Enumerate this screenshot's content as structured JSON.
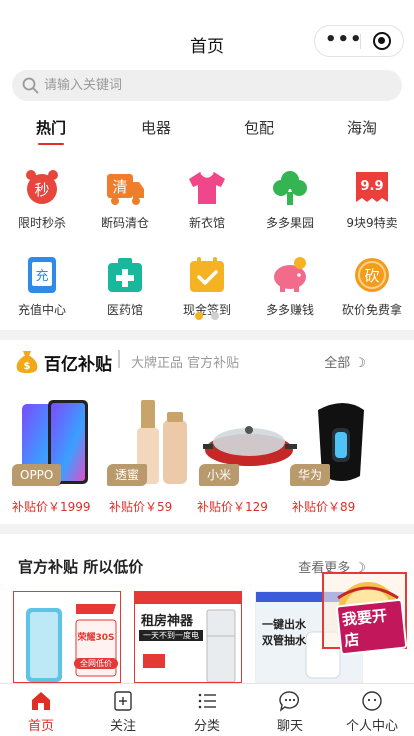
{
  "header": {
    "title": "首页"
  },
  "search": {
    "placeholder": "请输入关键词"
  },
  "tabs": [
    {
      "label": "热门"
    },
    {
      "label": "电器"
    },
    {
      "label": "包配"
    },
    {
      "label": "海淘"
    }
  ],
  "categories": [
    {
      "label": "限时秒杀",
      "icon": "flash-sale-clock-icon",
      "glyph": "秒",
      "color": "#e8453c"
    },
    {
      "label": "断码清仓",
      "icon": "clearance-truck-icon",
      "glyph": "清",
      "color": "#f07d2a"
    },
    {
      "label": "新衣馆",
      "icon": "tshirt-icon",
      "color": "#f0468a"
    },
    {
      "label": "多多果园",
      "icon": "tree-icon",
      "color": "#35b552"
    },
    {
      "label": "9块9特卖",
      "icon": "nine-nine-icon",
      "glyph": "9.9",
      "color": "#ea3f3a"
    },
    {
      "label": "充值中心",
      "icon": "recharge-phone-icon",
      "glyph": "充",
      "color": "#2f8be8"
    },
    {
      "label": "医药馆",
      "icon": "medicine-box-icon",
      "color": "#19b89c"
    },
    {
      "label": "现金签到",
      "icon": "calendar-check-icon",
      "color": "#f5b324"
    },
    {
      "label": "多多赚钱",
      "icon": "piggy-bank-icon",
      "color": "#f26b8a"
    },
    {
      "label": "砍价免费拿",
      "icon": "bargain-coin-icon",
      "glyph": "砍",
      "color": "#f29b1d"
    }
  ],
  "subsidy": {
    "title": "百亿补贴",
    "subtitle": "大牌正品 官方补贴",
    "more": "全部 ☽",
    "products": [
      {
        "brand": "OPPO",
        "price": "补贴价￥1999",
        "icon": "phone-product-icon"
      },
      {
        "brand": "透蜜",
        "price": "补贴价￥59",
        "icon": "foundation-bottle-icon"
      },
      {
        "brand": "小米",
        "price": "补贴价￥129",
        "icon": "electric-pan-icon"
      },
      {
        "brand": "华为",
        "price": "补贴价￥89",
        "icon": "smart-band-icon"
      }
    ]
  },
  "official": {
    "title": "官方补贴 所以低价",
    "more": "查看更多 ☽",
    "banners": [
      {
        "line1": "荣耀30S",
        "line2": "全网低价",
        "icon": "phone-banner-icon"
      },
      {
        "line1": "租房神器",
        "line2": "一天不到一度电",
        "icon": "fridge-banner-icon"
      },
      {
        "line1": "一键出水",
        "line2": "双管抽水",
        "icon": "dispenser-banner-icon"
      }
    ],
    "promo": "我要开店"
  },
  "tabbar": [
    {
      "label": "首页",
      "icon": "home-icon"
    },
    {
      "label": "关注",
      "icon": "follow-icon"
    },
    {
      "label": "分类",
      "icon": "category-icon"
    },
    {
      "label": "聊天",
      "icon": "chat-icon"
    },
    {
      "label": "个人中心",
      "icon": "profile-icon"
    }
  ],
  "colors": {
    "accent": "#e02e24",
    "tag": "#b99a6d"
  }
}
